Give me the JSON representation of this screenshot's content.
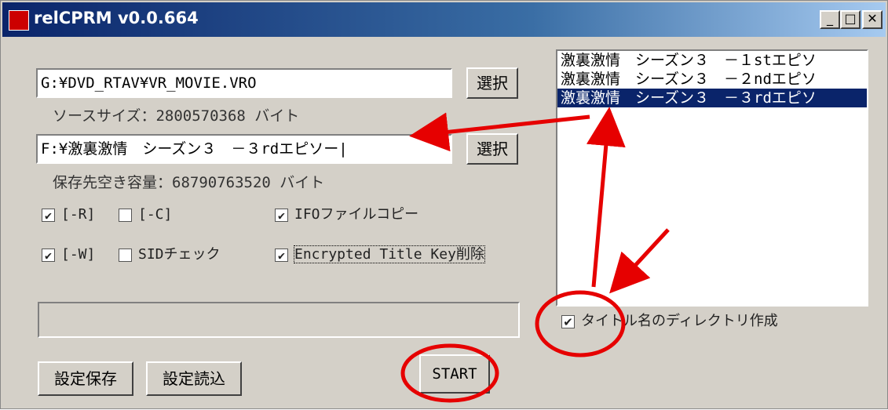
{
  "window": {
    "title": "relCPRM v0.0.664",
    "controls": {
      "minimize": "_",
      "maximize": "□",
      "close": "✕"
    }
  },
  "source": {
    "path": "G:¥DVD_RTAV¥VR_MOVIE.VRO",
    "browse_label": "選択",
    "size_text": "ソースサイズ：2800570368 バイト"
  },
  "dest": {
    "path": "F:¥激裏激情　シーズン３　－３rdエピソー|",
    "browse_label": "選択",
    "free_text": "保存先空き容量：68790763520 バイト"
  },
  "options": [
    {
      "label": "[-R]",
      "checked": true
    },
    {
      "label": "[-C]",
      "checked": false
    },
    {
      "label": "IFOファイルコピー",
      "checked": true
    },
    {
      "label": "[-W]",
      "checked": true
    },
    {
      "label": "SIDチェック",
      "checked": false
    },
    {
      "label": "Encrypted Title Key削除",
      "checked": true
    }
  ],
  "titles": [
    "激裏激情　シーズン３　－１stエピソ",
    "激裏激情　シーズン３　－２ndエピソ",
    "激裏激情　シーズン３　－３rdエピソ"
  ],
  "selected_title_index": 2,
  "dir_option": {
    "label": "タイトル名のディレクトリ作成",
    "checked": true
  },
  "buttons": {
    "save": "設定保存",
    "load": "設定読込",
    "start": "START"
  },
  "progress": 0,
  "colors": {
    "annotation": "#e60000",
    "titlebar": "#0a246a",
    "selection": "#0a246a"
  }
}
